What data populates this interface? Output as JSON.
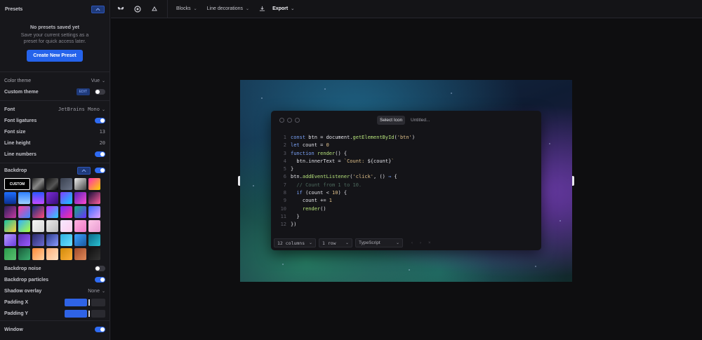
{
  "sidebar": {
    "presets": {
      "title": "Presets",
      "empty_title": "No presets saved yet",
      "empty_desc": "Save your current settings as a preset for quick access later.",
      "create_label": "Create New Preset"
    },
    "settings": [
      {
        "label": "Color theme",
        "value": "Vue"
      },
      {
        "label": "Custom theme",
        "badge": "EDIT"
      },
      {
        "label": "Font",
        "value": "JetBrains Mono"
      },
      {
        "label": "Font ligatures"
      },
      {
        "label": "Font size",
        "value": "13"
      },
      {
        "label": "Line height",
        "value": "20"
      },
      {
        "label": "Line numbers"
      }
    ],
    "backdrop": {
      "title": "Backdrop",
      "custom_label": "CUSTOM",
      "noise_label": "Backdrop noise",
      "particles_label": "Backdrop particles",
      "shadow_label": "Shadow overlay",
      "shadow_value": "None",
      "padding_x_label": "Padding X",
      "padding_y_label": "Padding Y",
      "window_label": "Window"
    },
    "swatches": [
      "linear-gradient(135deg,#222,#888 50%,#111)",
      "linear-gradient(135deg,#111,#555 60%,#000)",
      "linear-gradient(135deg,#3a4150,#6a7386)",
      "linear-gradient(135deg,#eee,#aaa 40%,#444)",
      "linear-gradient(135deg,#ff2fb0,#ffd400)",
      "linear-gradient(180deg,#1e6fff,#0b2f8f)",
      "linear-gradient(180deg,#2f80ff,#9fd0ff)",
      "linear-gradient(180deg,#2b56ff,#c34bff)",
      "linear-gradient(135deg,#7c2bd9,#3a0f7a)",
      "linear-gradient(135deg,#7f3fff,#13c8ff)",
      "linear-gradient(135deg,#5522bb,#ff4ad0)",
      "linear-gradient(135deg,#1a0f3a,#ff5f9e)",
      "linear-gradient(135deg,#2a1f5a,#c53aa0)",
      "linear-gradient(135deg,#ff3da0,#3a8bff)",
      "linear-gradient(135deg,#0f2f7f,#ff4a7a)",
      "linear-gradient(135deg,#bb2fff,#2ad0ff)",
      "linear-gradient(135deg,#6b2fff,#ff2fa0)",
      "linear-gradient(135deg,#18b07a,#6a2fff)",
      "linear-gradient(135deg,#3a6aff,#e0a0ff)",
      "linear-gradient(135deg,#16c0a0,#ffd23a)",
      "linear-gradient(135deg,#2fb0ff,#b0ff3a)",
      "linear-gradient(135deg,#f4f4f4,#d8d8d8)",
      "linear-gradient(135deg,#e8e8e8,#bdbdbd)",
      "linear-gradient(135deg,#f6e8ff,#ffd0f0)",
      "linear-gradient(135deg,#ffb0e0,#f07ac8)",
      "linear-gradient(135deg,#ffc8e8,#e89ad0)",
      "linear-gradient(135deg,#b79bff,#6c3de0)",
      "linear-gradient(135deg,#5a2fb0,#9a5aff)",
      "linear-gradient(135deg,#2a2a6a,#6a6ad0)",
      "linear-gradient(135deg,#2a3a8a,#8a9aff)",
      "linear-gradient(135deg,#2fb0e0,#6ae0ff)",
      "linear-gradient(135deg,#3aa0ff,#1a5aa0)",
      "linear-gradient(135deg,#0a6a8a,#2ac0d0)",
      "linear-gradient(135deg,#2a9a4a,#5ac070)",
      "linear-gradient(135deg,#1a5a3a,#3ab070)",
      "linear-gradient(135deg,#ff8a3a,#ffd0a0)",
      "linear-gradient(135deg,#ffb07a,#ffe0c0)",
      "linear-gradient(135deg,#d08a0a,#ffb03a)",
      "linear-gradient(135deg,#a04a2a,#e08a5a)",
      "linear-gradient(135deg,#111,#333)"
    ]
  },
  "toolbar": {
    "blocks_label": "Blocks",
    "line_decorations_label": "Line decorations",
    "export_label": "Export"
  },
  "editor": {
    "select_icon_label": "Select Icon",
    "window_title": "Untitled...",
    "footer": {
      "columns": "12 columns",
      "rows": "1 row",
      "language": "TypeScript"
    },
    "code_lines": [
      "const btn = document.getElementById('btn')",
      "let count = 0",
      "function render() {",
      "  btn.innerText = `Count: ${count}`",
      "}",
      "btn.addEventListener('click', () => {",
      "  // Count from 1 to 10.",
      "  if (count < 10) {",
      "    count += 1",
      "    render()",
      "  }",
      "})"
    ]
  }
}
